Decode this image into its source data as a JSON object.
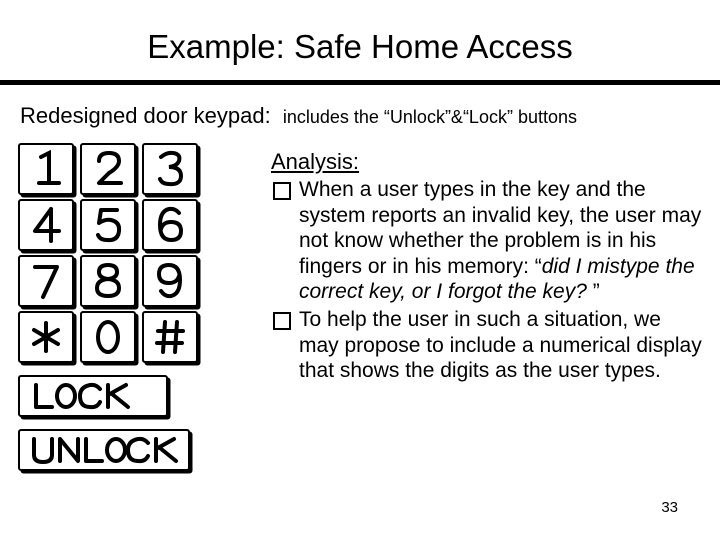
{
  "title": "Example: Safe Home Access",
  "subtitle": "Redesigned door keypad:",
  "subtitle_note": "includes the “Unlock”&“Lock” buttons",
  "keypad": {
    "keys": [
      "1",
      "2",
      "3",
      "4",
      "5",
      "6",
      "7",
      "8",
      "9",
      "*",
      "0",
      "#"
    ],
    "lock_label": "LOCK",
    "unlock_label": "UNLOCK"
  },
  "analysis": {
    "heading": "Analysis:",
    "bullets": [
      {
        "pre": "When a user types in the key and the system reports an invalid key, the user may not know whether the problem is in his fingers or in his memory: “",
        "italic": "did I mistype the correct key, or I forgot the key?",
        "post": " ”"
      },
      {
        "pre": "To help the user in such a situation, we may propose to include a numerical display that shows the digits as the user types.",
        "italic": "",
        "post": ""
      }
    ]
  },
  "page_number": "33"
}
